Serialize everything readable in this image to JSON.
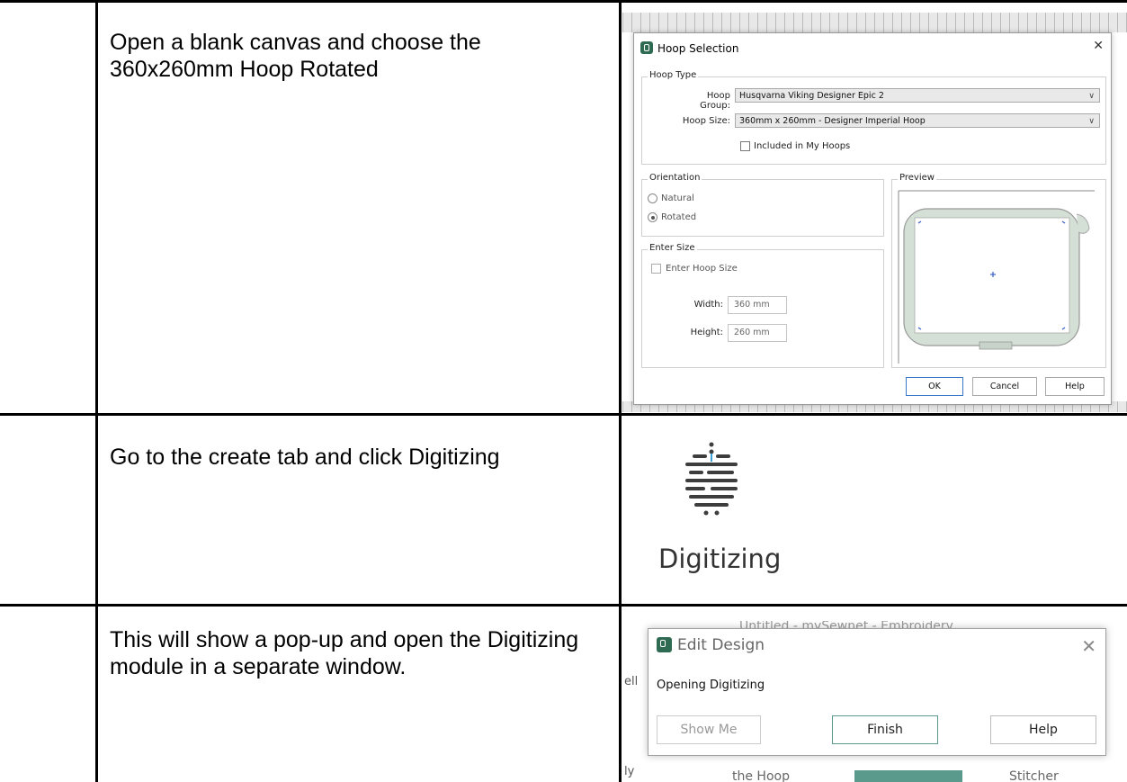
{
  "rows": [
    {
      "instruction": "Open a blank canvas and choose the 360x260mm Hoop Rotated"
    },
    {
      "instruction": "Go to the create tab and click Digitizing"
    },
    {
      "instruction": "This will show a pop-up and open the Digitizing module in a separate window."
    }
  ],
  "hoop_dialog": {
    "title": "Hoop Selection",
    "hoop_type_label": "Hoop Type",
    "hoop_group_label": "Hoop Group:",
    "hoop_group_value": "Husqvarna Viking Designer Epic 2",
    "hoop_size_label": "Hoop Size:",
    "hoop_size_value": "360mm x 260mm - Designer Imperial Hoop",
    "included_label": "Included in My Hoops",
    "orientation_label": "Orientation",
    "natural_label": "Natural",
    "rotated_label": "Rotated",
    "orientation_selected": "Rotated",
    "enter_size_label": "Enter Size",
    "enter_hoop_size_label": "Enter Hoop Size",
    "width_label": "Width:",
    "width_value": "360 mm",
    "height_label": "Height:",
    "height_value": "260 mm",
    "preview_label": "Preview",
    "ok_label": "OK",
    "cancel_label": "Cancel",
    "help_label": "Help"
  },
  "digitizing": {
    "label": "Digitizing"
  },
  "edit_dialog": {
    "background_title": "Untitled - mySewnet - Embroidery",
    "background_bottom_left": "the Hoop",
    "background_bottom_right": "Stitcher",
    "title": "Edit Design",
    "message": "Opening Digitizing",
    "show_me_label": "Show Me",
    "finish_label": "Finish",
    "help_label": "Help"
  }
}
